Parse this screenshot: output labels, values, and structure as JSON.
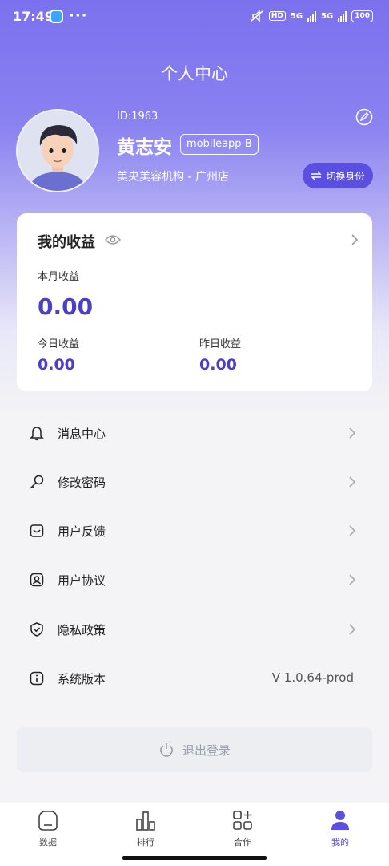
{
  "status_bar": {
    "time": "17:49",
    "dots": "···",
    "network_hd": "HD",
    "signal_1": "5G",
    "signal_2": "5G",
    "battery": "100"
  },
  "header": {
    "title": "个人中心"
  },
  "profile": {
    "id_text": "ID:1963",
    "name": "黄志安",
    "role_tag": "mobileapp-B",
    "org": "美央美容机构 - 广州店",
    "switch_label": "切换身份"
  },
  "earnings": {
    "title": "我的收益",
    "month_label": "本月收益",
    "month_value": "0.00",
    "today_label": "今日收益",
    "today_value": "0.00",
    "yesterday_label": "昨日收益",
    "yesterday_value": "0.00"
  },
  "menu": [
    {
      "label": "消息中心",
      "icon": "bell-icon"
    },
    {
      "label": "修改密码",
      "icon": "key-icon"
    },
    {
      "label": "用户反馈",
      "icon": "feedback-icon"
    },
    {
      "label": "用户协议",
      "icon": "user-badge-icon"
    },
    {
      "label": "隐私政策",
      "icon": "shield-icon"
    },
    {
      "label": "系统版本",
      "icon": "info-icon",
      "value": "V 1.0.64-prod"
    }
  ],
  "logout": {
    "label": "退出登录",
    "icon": "power-icon"
  },
  "tabbar": [
    {
      "label": "数据",
      "icon": "home-data-icon",
      "active": false
    },
    {
      "label": "排行",
      "icon": "bar-chart-icon",
      "active": false
    },
    {
      "label": "合作",
      "icon": "grid-plus-icon",
      "active": false
    },
    {
      "label": "我的",
      "icon": "person-icon",
      "active": true
    }
  ],
  "colors": {
    "accent": "#5a4fe0",
    "value": "#4b3fc8",
    "header_top": "#7b71ee"
  }
}
